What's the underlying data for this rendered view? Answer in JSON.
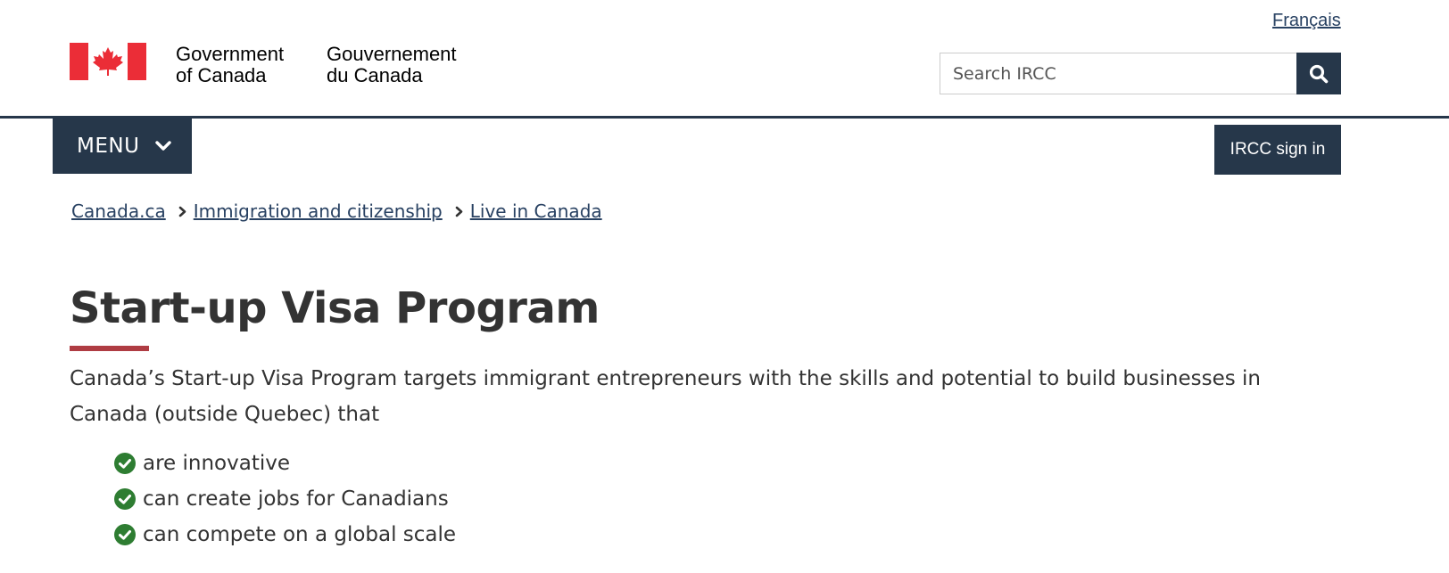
{
  "header": {
    "language_link": "Français",
    "brand": {
      "en_line1": "Government",
      "en_line2": "of Canada",
      "fr_line1": "Gouvernement",
      "fr_line2": "du Canada",
      "flag_icon": "canada-flag-icon"
    },
    "search": {
      "placeholder": "Search IRCC",
      "value": "",
      "button_icon": "search-icon"
    }
  },
  "nav": {
    "menu_label": "MENU",
    "menu_icon": "chevron-down-icon",
    "signin_label": "IRCC sign in"
  },
  "breadcrumb": {
    "items": [
      {
        "label": "Canada.ca"
      },
      {
        "label": "Immigration and citizenship"
      },
      {
        "label": "Live in Canada"
      }
    ],
    "separator_icon": "chevron-right-icon"
  },
  "main": {
    "title": "Start-up Visa Program",
    "intro": "Canada’s Start-up Visa Program targets immigrant entrepreneurs with the skills and potential to build businesses in Canada (outside Quebec) that",
    "checklist": [
      {
        "text": "are innovative"
      },
      {
        "text": "can create jobs for Canadians"
      },
      {
        "text": "can compete on a global scale"
      }
    ],
    "check_icon": "check-circle-icon"
  },
  "colors": {
    "navy": "#26374a",
    "link": "#284162",
    "flag_red": "#eb2d37",
    "title_accent": "#af3c43",
    "check_green": "#278400"
  }
}
